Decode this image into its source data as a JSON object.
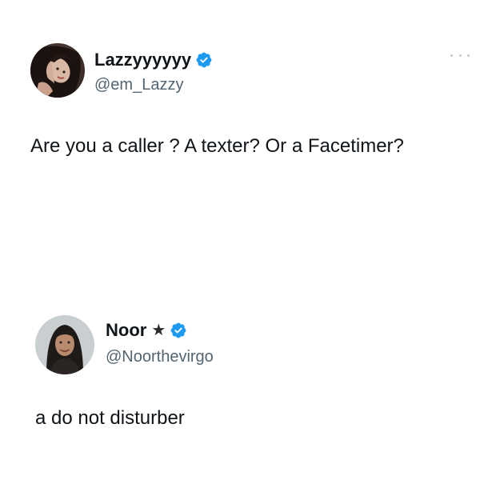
{
  "tweets": [
    {
      "display_name": "Lazzyyyyyy",
      "handle": "@em_Lazzy",
      "text": "Are you a caller ? A texter? Or a Facetimer?",
      "verified": true,
      "avatar_icon": "profile-photo"
    },
    {
      "display_name": "Noor",
      "name_symbol": "★",
      "handle": "@Noorthevirgo",
      "text": "a do not disturber",
      "verified": true,
      "avatar_icon": "profile-photo"
    }
  ],
  "icons": {
    "verified": "verified-badge-icon",
    "more": "more-options-icon"
  },
  "colors": {
    "verified_blue": "#1d9bf0",
    "text_primary": "#0f1419",
    "text_secondary": "#536471",
    "background": "#ffffff"
  }
}
